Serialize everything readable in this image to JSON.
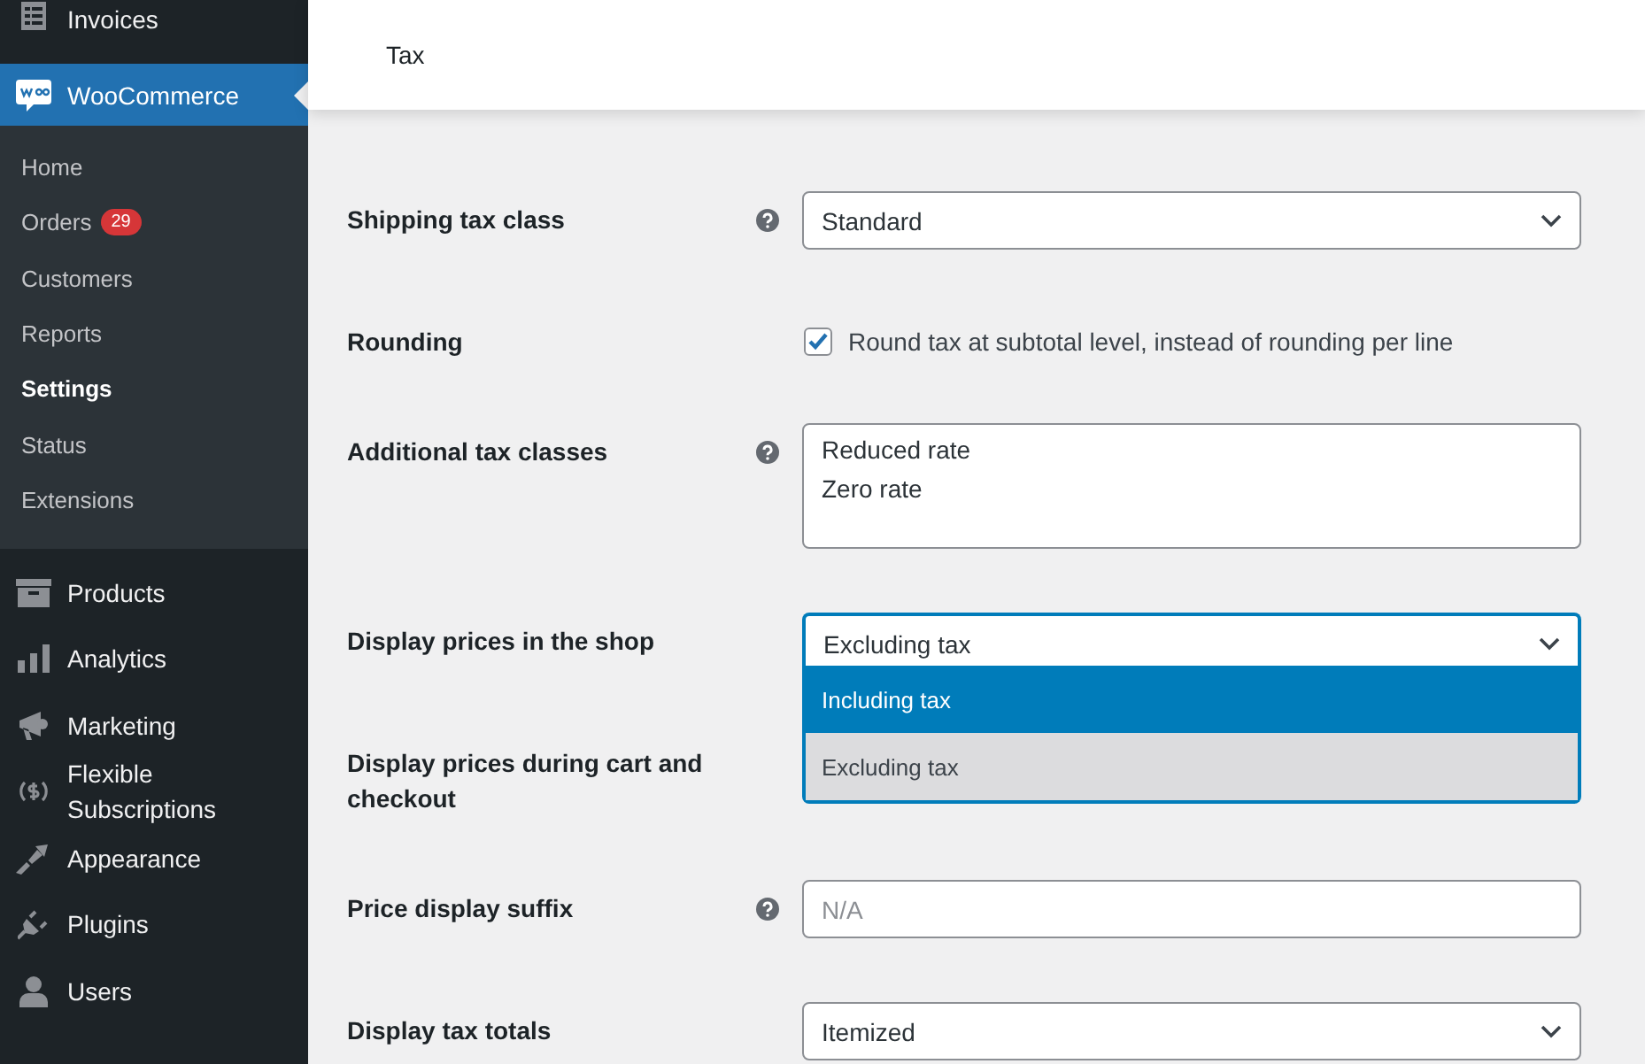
{
  "sidebar": {
    "items": [
      {
        "label": "Invoices",
        "selected": false
      },
      {
        "label": "WooCommerce",
        "selected": true,
        "submenu": [
          {
            "label": "Home",
            "selected": false
          },
          {
            "label": "Orders",
            "badge": "29",
            "selected": false
          },
          {
            "label": "Customers",
            "selected": false
          },
          {
            "label": "Reports",
            "selected": false
          },
          {
            "label": "Settings",
            "selected": true
          },
          {
            "label": "Status",
            "selected": false
          },
          {
            "label": "Extensions",
            "selected": false
          }
        ]
      },
      {
        "label": "Products",
        "selected": false
      },
      {
        "label": "Analytics",
        "selected": false
      },
      {
        "label": "Marketing",
        "selected": false
      },
      {
        "label": "Flexible Subscriptions",
        "selected": false
      },
      {
        "label": "Appearance",
        "selected": false
      },
      {
        "label": "Plugins",
        "selected": false
      },
      {
        "label": "Users",
        "selected": false
      }
    ]
  },
  "header": {
    "title": "Tax"
  },
  "settings": [
    {
      "kind": "select",
      "label": "Shipping tax class",
      "help": true,
      "value": "Standard"
    },
    {
      "kind": "checkbox",
      "label": "Rounding",
      "help": false,
      "checked": true,
      "text": "Round tax at subtotal level, instead of rounding per line"
    },
    {
      "kind": "textarea",
      "label": "Additional tax classes",
      "help": true,
      "lines": [
        "Reduced rate",
        "Zero rate"
      ]
    },
    {
      "kind": "select",
      "label": "Display prices in the shop",
      "help": false,
      "value": "Excluding tax",
      "open": true,
      "options": [
        {
          "label": "Including tax",
          "highlighted": true
        },
        {
          "label": "Excluding tax",
          "highlighted": false
        }
      ]
    },
    {
      "kind": "covered",
      "label": "Display prices during cart and checkout",
      "help": false
    },
    {
      "kind": "text",
      "label": "Price display suffix",
      "help": true,
      "placeholder": "N/A"
    },
    {
      "kind": "select",
      "label": "Display tax totals",
      "help": false,
      "value": "Itemized"
    }
  ]
}
